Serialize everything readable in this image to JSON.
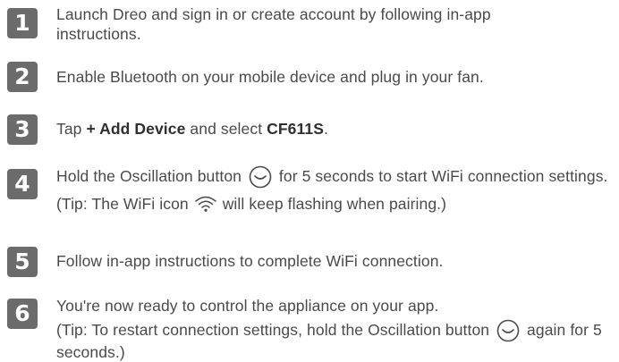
{
  "steps": [
    {
      "num": "1",
      "text": "Launch Dreo and sign in or create account by following in-app instructions."
    },
    {
      "num": "2",
      "text": "Enable Bluetooth on your mobile device and plug in your fan."
    },
    {
      "num": "3",
      "pre": "Tap ",
      "bold1": "+ Add Device",
      "mid": " and select ",
      "bold2": "CF611S",
      "post": "."
    },
    {
      "num": "4",
      "pre": "Hold the Oscillation button ",
      "post": " for 5 seconds to start WiFi connection settings.",
      "tip_pre": "(Tip: The WiFi icon ",
      "tip_post": " will keep flashing when pairing.)"
    },
    {
      "num": "5",
      "text": "Follow in-app instructions to complete WiFi connection."
    },
    {
      "num": "6",
      "text": "You're now ready to control the appliance on your app.",
      "tip_pre": "(Tip: To restart connection settings, hold the Oscillation button ",
      "tip_post": " again for 5 seconds.)"
    }
  ],
  "icons": {
    "oscillation": "oscillation-icon",
    "wifi": "wifi-icon"
  },
  "colors": {
    "badge": "#6b6b6b",
    "text": "#4a4a4a"
  }
}
